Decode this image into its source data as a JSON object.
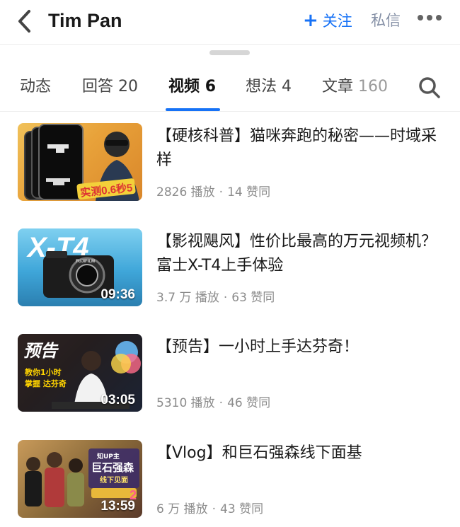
{
  "header": {
    "title": "Tim Pan",
    "follow_label": "关注",
    "message_label": "私信"
  },
  "tabs": [
    {
      "label": "动态",
      "count": ""
    },
    {
      "label": "回答",
      "count": "20"
    },
    {
      "label": "视频",
      "count": "6"
    },
    {
      "label": "想法",
      "count": "4"
    },
    {
      "label": "文章",
      "count": "160"
    }
  ],
  "videos": [
    {
      "title": "【硬核科普】猫咪奔跑的秘密——时域采样",
      "plays": "2826 播放",
      "likes": "14 赞同",
      "duration": "",
      "thumb_text": "实测0.6秒5"
    },
    {
      "title": "【影视飓风】性价比最高的万元视频机？富士X-T4上手体验",
      "plays": "3.7 万 播放",
      "likes": "63 赞同",
      "duration": "09:36",
      "thumb_text": "X-T4",
      "thumb_brand": "FUJIFILM"
    },
    {
      "title": "【预告】一小时上手达芬奇！",
      "plays": "5310 播放",
      "likes": "46 赞同",
      "duration": "03:05",
      "thumb_text": "预告",
      "thumb_sub1": "教你1小时",
      "thumb_sub2": "掌握 达芬奇"
    },
    {
      "title": "【Vlog】和巨石强森线下面基",
      "plays": "6 万 播放",
      "likes": "43 赞同",
      "duration": "13:59",
      "thumb_text": "巨石强森",
      "thumb_sub1": "知UP主",
      "thumb_sub2": "线下见面"
    }
  ],
  "colors": {
    "accent": "#1772f6",
    "muted": "#8c8c8c"
  }
}
